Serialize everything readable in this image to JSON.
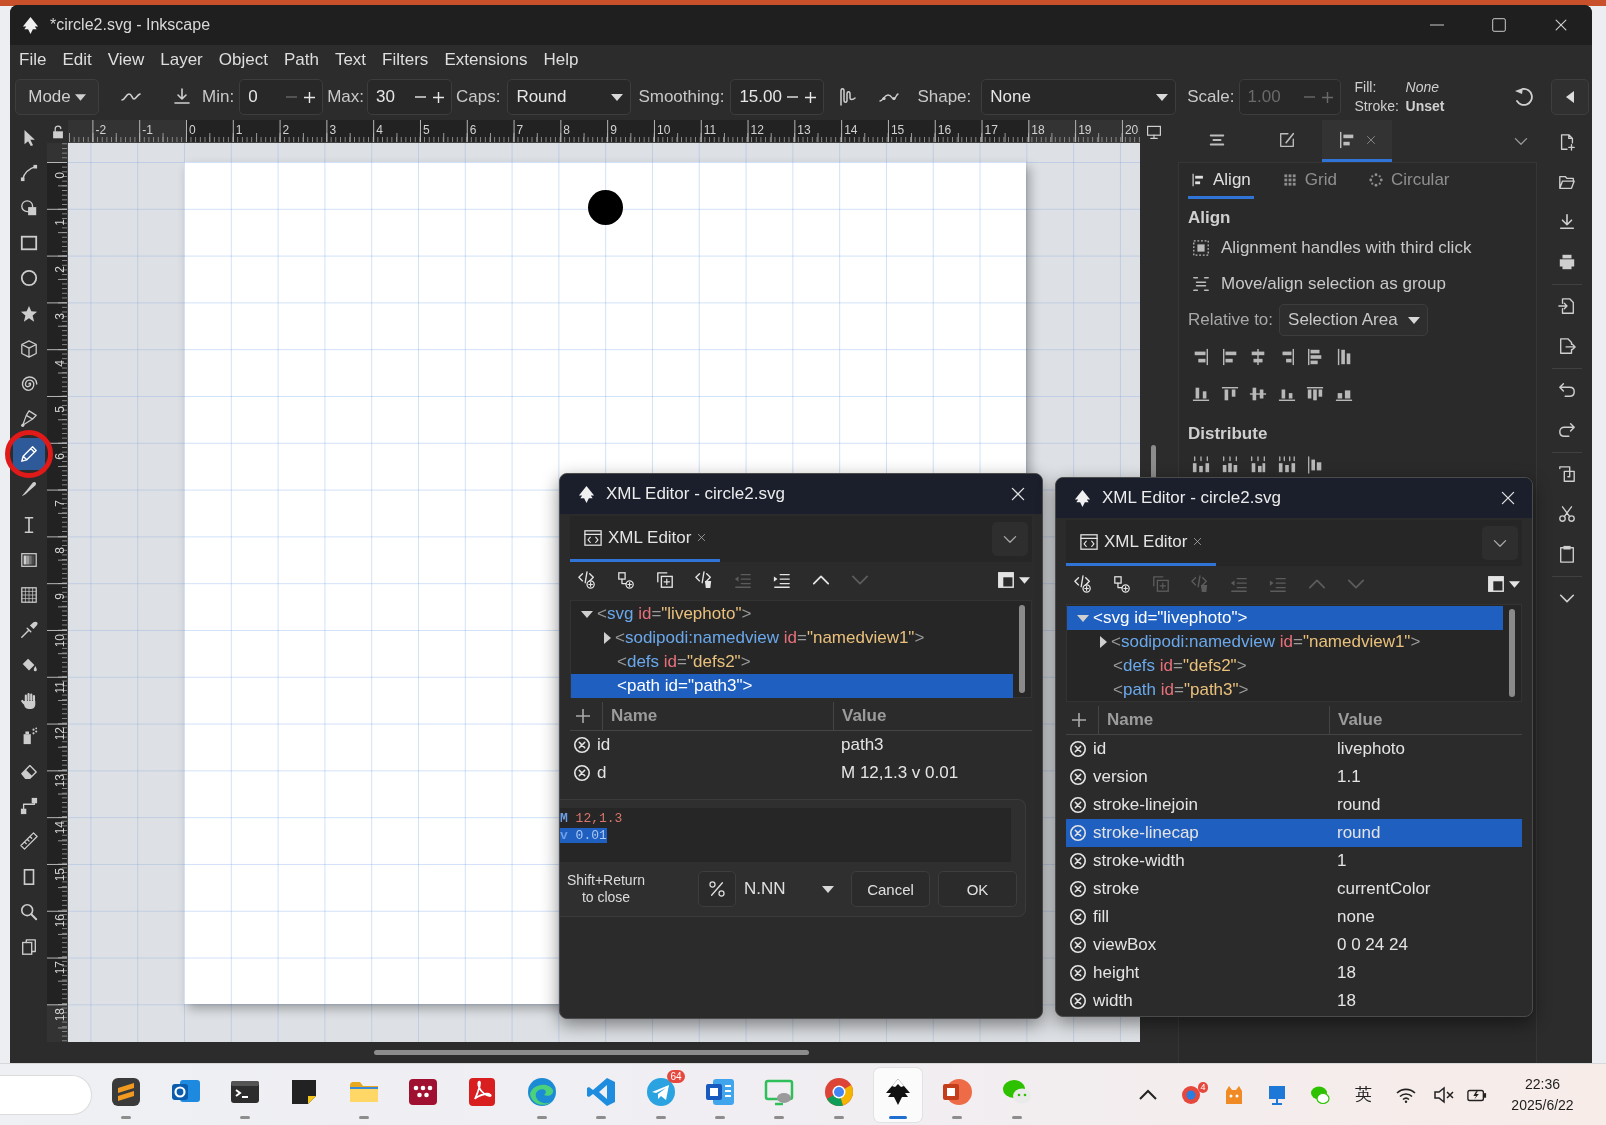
{
  "window": {
    "title": "*circle2.svg - Inkscape"
  },
  "menu": [
    "File",
    "Edit",
    "View",
    "Layer",
    "Object",
    "Path",
    "Text",
    "Filters",
    "Extensions",
    "Help"
  ],
  "tool_controls": {
    "mode": "Mode",
    "min": {
      "label": "Min:",
      "value": "0",
      "disabled": false,
      "decrement_disabled": true
    },
    "max": {
      "label": "Max:",
      "value": "30",
      "disabled": false,
      "decrement_disabled": false
    },
    "caps": {
      "label": "Caps:",
      "value": "Round"
    },
    "smoothing": {
      "label": "Smoothing:",
      "value": "15.00",
      "disabled": false,
      "decrement_disabled": false
    },
    "shape": {
      "label": "Shape:",
      "value": "None"
    },
    "scale": {
      "label": "Scale:",
      "value": "1.00",
      "disabled": true
    },
    "style": {
      "fill_label": "Fill:",
      "fill_value": "None",
      "stroke_label": "Stroke:",
      "stroke_value": "Unset"
    }
  },
  "rulers": {
    "horizontal": [
      "-2",
      "-1",
      "0",
      "1",
      "2",
      "3",
      "4",
      "5",
      "6",
      "7",
      "8",
      "9",
      "10",
      "11",
      "12",
      "13",
      "14",
      "15",
      "16",
      "17",
      "18",
      "19",
      "20"
    ],
    "vertical": [
      "0",
      "1",
      "2",
      "3",
      "4",
      "5",
      "6",
      "7",
      "8",
      "9",
      "10",
      "11",
      "12",
      "13",
      "14",
      "15",
      "16",
      "17",
      "18"
    ]
  },
  "toolbox": [
    {
      "kind": "select",
      "selected": false,
      "circled": false
    },
    {
      "kind": "node",
      "selected": false,
      "circled": false
    },
    {
      "kind": "builder",
      "selected": false,
      "circled": false
    },
    {
      "kind": "rect",
      "selected": false,
      "circled": false
    },
    {
      "kind": "ellipse",
      "selected": false,
      "circled": false
    },
    {
      "kind": "star",
      "selected": false,
      "circled": false
    },
    {
      "kind": "box",
      "selected": false,
      "circled": false
    },
    {
      "kind": "spiral",
      "selected": false,
      "circled": false
    },
    {
      "kind": "pen",
      "selected": false,
      "circled": false
    },
    {
      "kind": "pencil",
      "selected": true,
      "circled": true
    },
    {
      "kind": "calligraphy",
      "selected": false,
      "circled": false
    },
    {
      "kind": "text",
      "selected": false,
      "circled": false
    },
    {
      "kind": "gradient",
      "selected": false,
      "circled": false
    },
    {
      "kind": "mesh",
      "selected": false,
      "circled": false
    },
    {
      "kind": "dropper",
      "selected": false,
      "circled": false
    },
    {
      "kind": "bucket",
      "selected": false,
      "circled": false
    },
    {
      "kind": "tweak",
      "selected": false,
      "circled": false
    },
    {
      "kind": "spray",
      "selected": false,
      "circled": false
    },
    {
      "kind": "eraser",
      "selected": false,
      "circled": false
    },
    {
      "kind": "connector",
      "selected": false,
      "circled": false
    },
    {
      "kind": "measure",
      "selected": false,
      "circled": false
    },
    {
      "kind": "page",
      "selected": false,
      "circled": false
    },
    {
      "kind": "zoom",
      "selected": false,
      "circled": false
    },
    {
      "kind": "pages",
      "selected": false,
      "circled": false
    }
  ],
  "dock": {
    "tabs": [
      {
        "kind": "layers",
        "selected": false
      },
      {
        "kind": "brush",
        "selected": false
      },
      {
        "kind": "align",
        "selected": true
      }
    ],
    "align": {
      "subtabs": [
        {
          "kind": "align",
          "label": "Align",
          "selected": true
        },
        {
          "kind": "grid",
          "label": "Grid",
          "selected": false
        },
        {
          "kind": "circular",
          "label": "Circular",
          "selected": false
        }
      ],
      "heading": "Align",
      "options": [
        {
          "kind": "handles",
          "label": "Alignment handles with third click"
        },
        {
          "kind": "group",
          "label": "Move/align selection as group"
        }
      ],
      "relative_label": "Relative to:",
      "relative_value": "Selection Area",
      "distribute_heading": "Distribute"
    }
  },
  "xml_editors": [
    {
      "title": "XML Editor - circle2.svg",
      "tabs": [
        {
          "label": "XML Editor",
          "selected": true
        }
      ],
      "toolbar": [
        {
          "kind": "element",
          "disabled": false
        },
        {
          "kind": "textnode",
          "disabled": false
        },
        {
          "kind": "duplicate",
          "disabled": false
        },
        {
          "kind": "delete",
          "disabled": false
        },
        {
          "kind": "unindent",
          "disabled": true
        },
        {
          "kind": "indent",
          "disabled": false
        },
        {
          "kind": "raise",
          "disabled": false
        },
        {
          "kind": "lower",
          "disabled": true
        }
      ],
      "tree": [
        {
          "tokens": [
            {
              "kind": "punct",
              "text": "<"
            },
            {
              "kind": "tag",
              "text": "svg"
            },
            {
              "kind": "attr",
              "text": " id"
            },
            {
              "kind": "punct",
              "text": "="
            },
            {
              "kind": "value",
              "text": "\"livephoto\""
            },
            {
              "kind": "punct",
              "text": ">"
            }
          ],
          "expanded": true,
          "selected": false,
          "children": [
            {
              "tokens": [
                {
                  "kind": "punct",
                  "text": "<"
                },
                {
                  "kind": "tag",
                  "text": "sodipodi:namedview"
                },
                {
                  "kind": "attr",
                  "text": " id"
                },
                {
                  "kind": "punct",
                  "text": "="
                },
                {
                  "kind": "value",
                  "text": "\"namedview1\""
                },
                {
                  "kind": "punct",
                  "text": ">"
                }
              ],
              "expanded": false,
              "selected": false
            },
            {
              "tokens": [
                {
                  "kind": "punct",
                  "text": "<"
                },
                {
                  "kind": "tag",
                  "text": "defs"
                },
                {
                  "kind": "attr",
                  "text": " id"
                },
                {
                  "kind": "punct",
                  "text": "="
                },
                {
                  "kind": "value",
                  "text": "\"defs2\""
                },
                {
                  "kind": "punct",
                  "text": ">"
                }
              ],
              "selected": false
            },
            {
              "tokens": [
                {
                  "kind": "punct",
                  "text": "<"
                },
                {
                  "kind": "tag",
                  "text": "path"
                },
                {
                  "kind": "attr",
                  "text": " id"
                },
                {
                  "kind": "punct",
                  "text": "="
                },
                {
                  "kind": "value",
                  "text": "\"path3\""
                },
                {
                  "kind": "punct",
                  "text": ">"
                }
              ],
              "selected": true
            }
          ]
        }
      ],
      "attributes": {
        "name_header": "Name",
        "value_header": "Value",
        "rows": [
          {
            "name": "id",
            "value": "path3",
            "selected": false
          },
          {
            "name": "d",
            "value": "M 12,1.3 v 0.01",
            "selected": false
          }
        ]
      },
      "value_editor": {
        "lines": [
          {
            "selected": false,
            "tokens": [
              {
                "kind": "command",
                "text": "M"
              },
              {
                "kind": "number",
                "text": " 12,1.3"
              }
            ]
          },
          {
            "selected": true,
            "tokens": [
              {
                "kind": "command",
                "text": "v"
              },
              {
                "kind": "number",
                "text": " 0.01"
              }
            ]
          }
        ],
        "hint": "Shift+Return to close",
        "format": "N.NN",
        "buttons": [
          "Cancel",
          "OK"
        ]
      }
    },
    {
      "title": "XML Editor - circle2.svg",
      "tabs": [
        {
          "label": "XML Editor",
          "selected": true
        }
      ],
      "toolbar": [
        {
          "kind": "element",
          "disabled": false
        },
        {
          "kind": "textnode",
          "disabled": false
        },
        {
          "kind": "duplicate",
          "disabled": true
        },
        {
          "kind": "delete",
          "disabled": true
        },
        {
          "kind": "unindent",
          "disabled": true
        },
        {
          "kind": "indent",
          "disabled": true
        },
        {
          "kind": "raise",
          "disabled": true
        },
        {
          "kind": "lower",
          "disabled": true
        }
      ],
      "tree": [
        {
          "tokens": [
            {
              "kind": "punct",
              "text": "<"
            },
            {
              "kind": "tag",
              "text": "svg"
            },
            {
              "kind": "attr",
              "text": " id"
            },
            {
              "kind": "punct",
              "text": "="
            },
            {
              "kind": "value",
              "text": "\"livephoto\""
            },
            {
              "kind": "punct",
              "text": ">"
            }
          ],
          "expanded": true,
          "selected": true,
          "children": [
            {
              "tokens": [
                {
                  "kind": "punct",
                  "text": "<"
                },
                {
                  "kind": "tag",
                  "text": "sodipodi:namedview"
                },
                {
                  "kind": "attr",
                  "text": " id"
                },
                {
                  "kind": "punct",
                  "text": "="
                },
                {
                  "kind": "value",
                  "text": "\"namedview1\""
                },
                {
                  "kind": "punct",
                  "text": ">"
                }
              ],
              "expanded": false,
              "selected": false
            },
            {
              "tokens": [
                {
                  "kind": "punct",
                  "text": "<"
                },
                {
                  "kind": "tag",
                  "text": "defs"
                },
                {
                  "kind": "attr",
                  "text": " id"
                },
                {
                  "kind": "punct",
                  "text": "="
                },
                {
                  "kind": "value",
                  "text": "\"defs2\""
                },
                {
                  "kind": "punct",
                  "text": ">"
                }
              ],
              "selected": false
            },
            {
              "tokens": [
                {
                  "kind": "punct",
                  "text": "<"
                },
                {
                  "kind": "tag",
                  "text": "path"
                },
                {
                  "kind": "attr",
                  "text": " id"
                },
                {
                  "kind": "punct",
                  "text": "="
                },
                {
                  "kind": "value",
                  "text": "\"path3\""
                },
                {
                  "kind": "punct",
                  "text": ">"
                }
              ],
              "selected": false
            }
          ]
        }
      ],
      "attributes": {
        "name_header": "Name",
        "value_header": "Value",
        "rows": [
          {
            "name": "id",
            "value": "livephoto",
            "selected": false
          },
          {
            "name": "version",
            "value": "1.1",
            "selected": false
          },
          {
            "name": "stroke-linejoin",
            "value": "round",
            "selected": false
          },
          {
            "name": "stroke-linecap",
            "value": "round",
            "selected": true
          },
          {
            "name": "stroke-width",
            "value": "1",
            "selected": false
          },
          {
            "name": "stroke",
            "value": "currentColor",
            "selected": false
          },
          {
            "name": "fill",
            "value": "none",
            "selected": false
          },
          {
            "name": "viewBox",
            "value": "0 0 24 24",
            "selected": false
          },
          {
            "name": "height",
            "value": "18",
            "selected": false
          },
          {
            "name": "width",
            "value": "18",
            "selected": false
          }
        ]
      }
    }
  ],
  "taskbar": {
    "apps": [
      {
        "kind": "sheet",
        "running": true,
        "selected": false
      },
      {
        "kind": "mail",
        "running": false,
        "selected": false
      },
      {
        "kind": "terminal",
        "running": true,
        "selected": false
      },
      {
        "kind": "note",
        "running": false,
        "selected": false
      },
      {
        "kind": "folder",
        "running": true,
        "selected": false
      },
      {
        "kind": "grid",
        "running": false,
        "selected": false
      },
      {
        "kind": "pdf",
        "running": false,
        "selected": false
      },
      {
        "kind": "globe",
        "running": true,
        "selected": false
      },
      {
        "kind": "code",
        "running": true,
        "selected": false
      },
      {
        "kind": "plane",
        "running": true,
        "selected": false,
        "badge": "64"
      },
      {
        "kind": "letter",
        "running": true,
        "selected": false
      },
      {
        "kind": "screen",
        "running": true,
        "selected": false
      },
      {
        "kind": "sphere",
        "running": true,
        "selected": false
      },
      {
        "kind": "pen",
        "running": true,
        "selected": true
      },
      {
        "kind": "slides",
        "running": true,
        "selected": false
      },
      {
        "kind": "chat",
        "running": true,
        "selected": false
      }
    ],
    "tray": {
      "badge": "4",
      "input_method": "英"
    },
    "clock": {
      "time": "22:36",
      "date": "2025/6/22"
    }
  }
}
